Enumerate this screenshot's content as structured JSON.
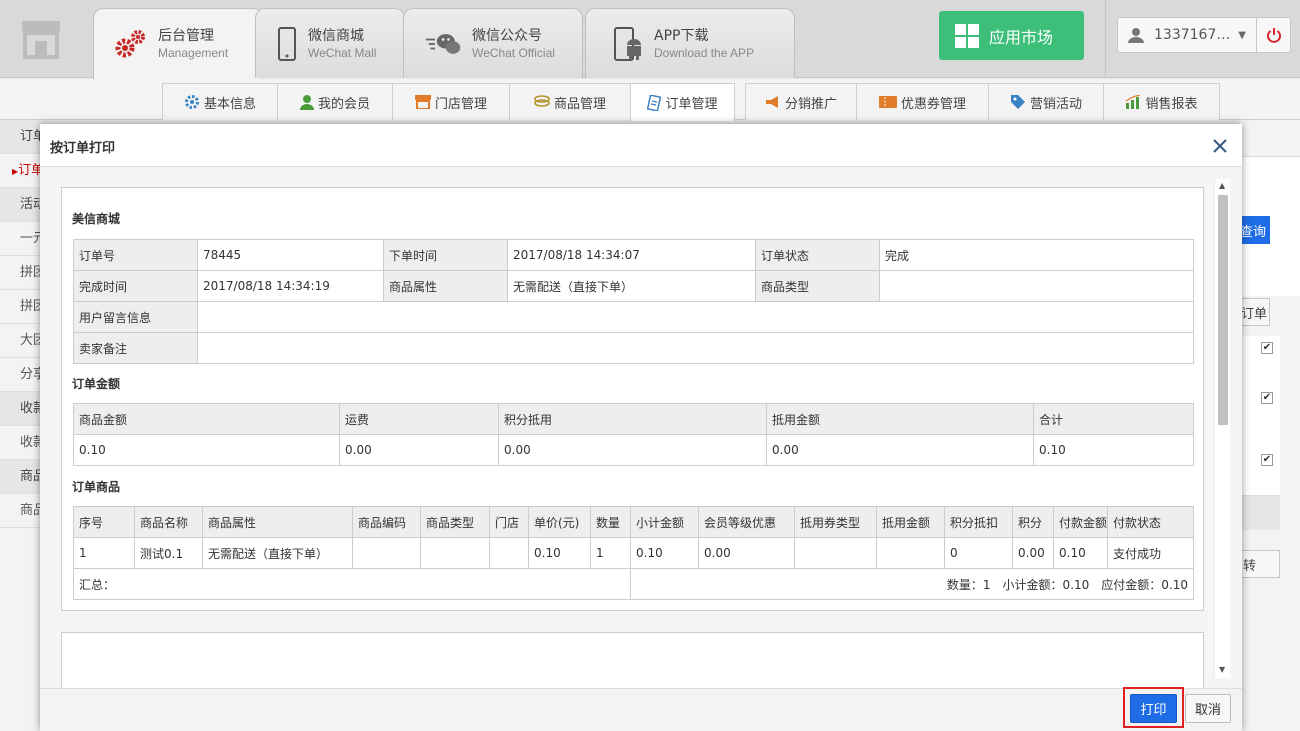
{
  "topbar": {
    "tabs": [
      {
        "title": "后台管理",
        "subtitle": "Management",
        "icon": "gears-icon",
        "active": true
      },
      {
        "title": "微信商城",
        "subtitle": "WeChat Mall",
        "icon": "mobile-phone-icon"
      },
      {
        "title": "微信公众号",
        "subtitle": "WeChat Official",
        "icon": "wechat-icon"
      },
      {
        "title": "APP下载",
        "subtitle": "Download the APP",
        "icon": "android-phone-icon"
      }
    ],
    "app_market": "应用市场",
    "user": "1337167…",
    "colors": {
      "app_market": "#3dbf7a",
      "power": "#d9262c"
    }
  },
  "subnav": {
    "tabs": [
      {
        "label": "基本信息",
        "icon": "gear-icon"
      },
      {
        "label": "我的会员",
        "icon": "user-icon"
      },
      {
        "label": "门店管理",
        "icon": "store-icon"
      },
      {
        "label": "商品管理",
        "icon": "coins-icon"
      },
      {
        "label": "订单管理",
        "icon": "order-icon",
        "active": true
      },
      {
        "label": "分销推广",
        "icon": "megaphone-icon"
      },
      {
        "label": "优惠券管理",
        "icon": "coupon-icon"
      },
      {
        "label": "营销活动",
        "icon": "tag-icon"
      },
      {
        "label": "销售报表",
        "icon": "chart-icon"
      }
    ]
  },
  "leftside": {
    "items": [
      {
        "label": "订单"
      },
      {
        "label": "订单"
      },
      {
        "label": "活动"
      },
      {
        "label": "一元"
      },
      {
        "label": "拼团"
      },
      {
        "label": "拼团"
      },
      {
        "label": "大团"
      },
      {
        "label": "分享"
      },
      {
        "label": "收款"
      },
      {
        "label": "收款"
      },
      {
        "label": "商品"
      },
      {
        "label": "商品"
      }
    ]
  },
  "background_right": {
    "query": "查询",
    "btn2": "订单",
    "btn3": "转"
  },
  "modal": {
    "title": "按订单打印",
    "print": "打印",
    "cancel": "取消",
    "shop_name": "美信商城",
    "order_info": {
      "order_no_label": "订单号",
      "order_no": "78445",
      "order_time_label": "下单时间",
      "order_time": "2017/08/18 14:34:07",
      "status_label": "订单状态",
      "status": "完成",
      "finish_time_label": "完成时间",
      "finish_time": "2017/08/18 14:34:19",
      "attr_label": "商品属性",
      "attr": "无需配送（直接下单）",
      "type_label": "商品类型",
      "type": "",
      "user_msg_label": "用户留言信息",
      "user_msg": "",
      "seller_note_label": "卖家备注",
      "seller_note": ""
    },
    "amount_title": "订单金额",
    "amount": {
      "headers": [
        "商品金额",
        "运费",
        "积分抵用",
        "抵用金额",
        "合计"
      ],
      "values": [
        "0.10",
        "0.00",
        "0.00",
        "0.00",
        "0.10"
      ]
    },
    "goods_title": "订单商品",
    "goods": {
      "headers": [
        "序号",
        "商品名称",
        "商品属性",
        "商品编码",
        "商品类型",
        "门店",
        "单价(元)",
        "数量",
        "小计金额",
        "会员等级优惠",
        "抵用券类型",
        "抵用金额",
        "积分抵扣",
        "积分",
        "付款金额",
        "付款状态"
      ],
      "rows": [
        [
          "1",
          "测试0.1",
          "无需配送（直接下单）",
          "",
          "",
          "",
          "0.10",
          "1",
          "0.10",
          "0.00",
          "",
          "",
          "0",
          "0.00",
          "0.10",
          "支付成功"
        ]
      ],
      "summary_label": "汇总：",
      "summary": "数量：1　小计金额：0.10　应付金额：0.10"
    }
  }
}
